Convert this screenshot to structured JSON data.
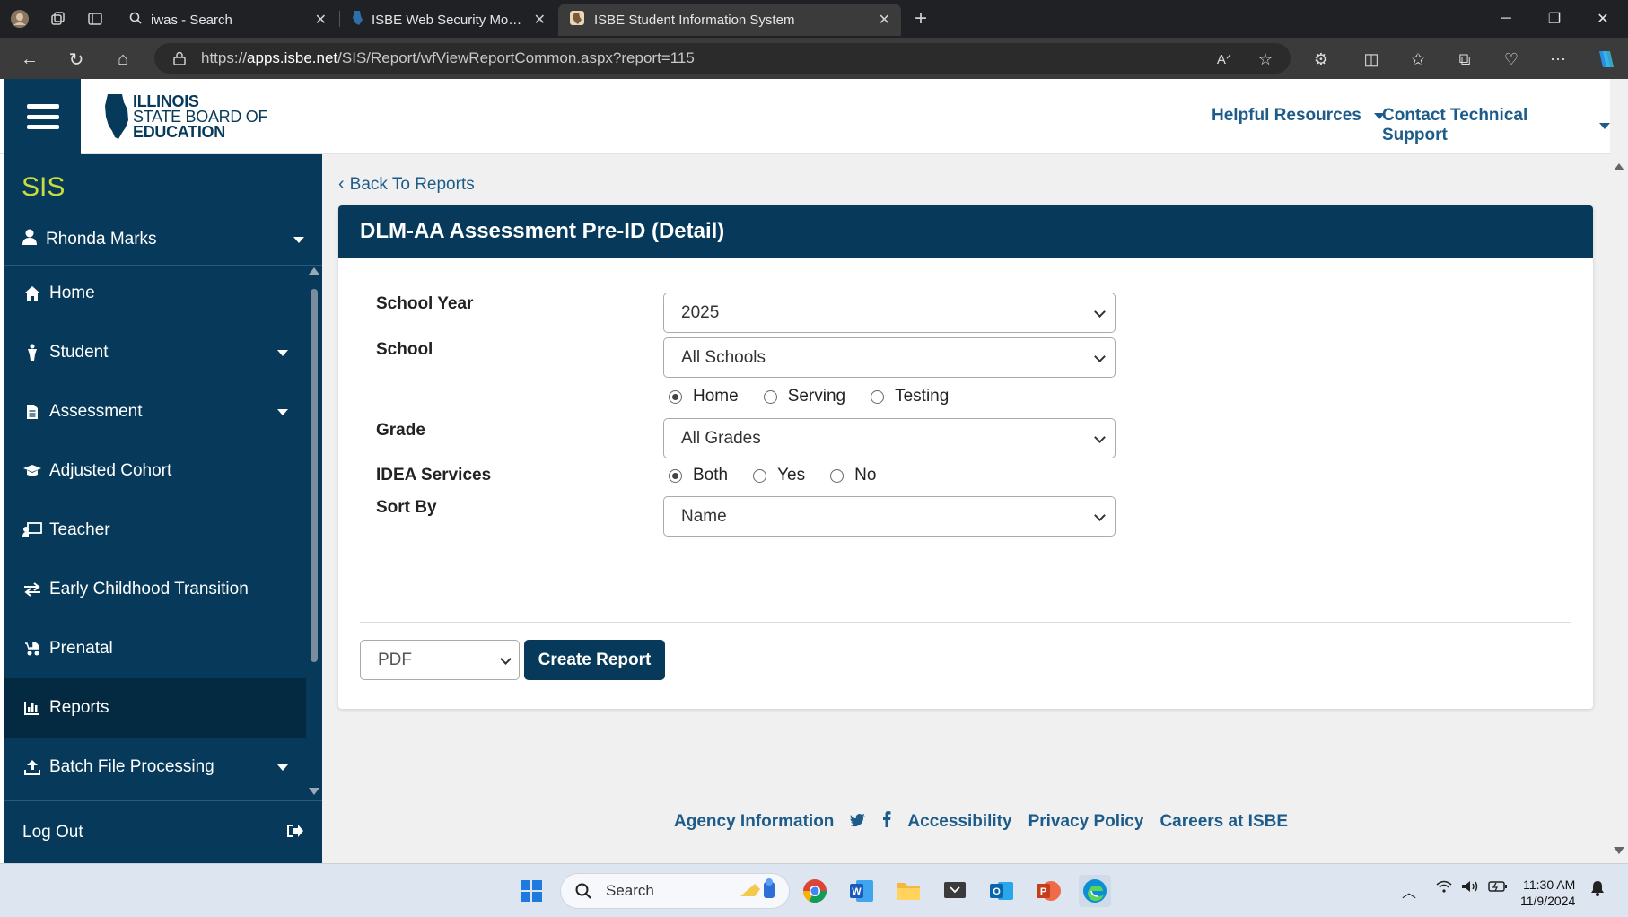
{
  "browser": {
    "tabs": [
      {
        "title": "iwas - Search"
      },
      {
        "title": "ISBE Web Security Module - Appli"
      },
      {
        "title": "ISBE Student Information System"
      }
    ],
    "url_prefix": "https://",
    "url_host": "apps.isbe.net",
    "url_path": "/SIS/Report/wfViewReportCommon.aspx?report=115"
  },
  "header": {
    "logo_line1": "ILLINOIS",
    "logo_line2": "STATE BOARD OF",
    "logo_line3": "EDUCATION",
    "helpful_resources": "Helpful Resources",
    "contact_support": "Contact Technical Support"
  },
  "sidebar": {
    "app_title": "SIS",
    "user_name": "Rhonda Marks",
    "items": [
      {
        "label": "Home",
        "icon": "home-icon"
      },
      {
        "label": "Student",
        "icon": "student-icon"
      },
      {
        "label": "Assessment",
        "icon": "document-icon"
      },
      {
        "label": "Adjusted Cohort",
        "icon": "graduation-cap-icon"
      },
      {
        "label": "Teacher",
        "icon": "teacher-icon"
      },
      {
        "label": "Early Childhood Transition",
        "icon": "exchange-icon"
      },
      {
        "label": "Prenatal",
        "icon": "baby-carriage-icon"
      },
      {
        "label": "Reports",
        "icon": "bar-chart-icon"
      },
      {
        "label": "Batch File Processing",
        "icon": "upload-icon"
      }
    ],
    "logout": "Log Out"
  },
  "main": {
    "back_link": "Back To Reports",
    "report_title": "DLM-AA Assessment Pre-ID (Detail)",
    "fields": {
      "school_year_label": "School Year",
      "school_year_value": "2025",
      "school_label": "School",
      "school_value": "All Schools",
      "school_type_options": [
        "Home",
        "Serving",
        "Testing"
      ],
      "school_type_selected": "Home",
      "grade_label": "Grade",
      "grade_value": "All Grades",
      "idea_label": "IDEA Services",
      "idea_options": [
        "Both",
        "Yes",
        "No"
      ],
      "idea_selected": "Both",
      "sort_label": "Sort By",
      "sort_value": "Name"
    },
    "format_value": "PDF",
    "create_button": "Create Report"
  },
  "footer": {
    "agency": "Agency Information",
    "accessibility": "Accessibility",
    "privacy": "Privacy Policy",
    "careers": "Careers at ISBE"
  },
  "taskbar": {
    "search_placeholder": "Search",
    "time": "11:30 AM",
    "date": "11/9/2024"
  },
  "colors": {
    "brand_navy": "#073a5a",
    "link_blue": "#1d5c8a",
    "sis_green": "#c8dc3c"
  }
}
